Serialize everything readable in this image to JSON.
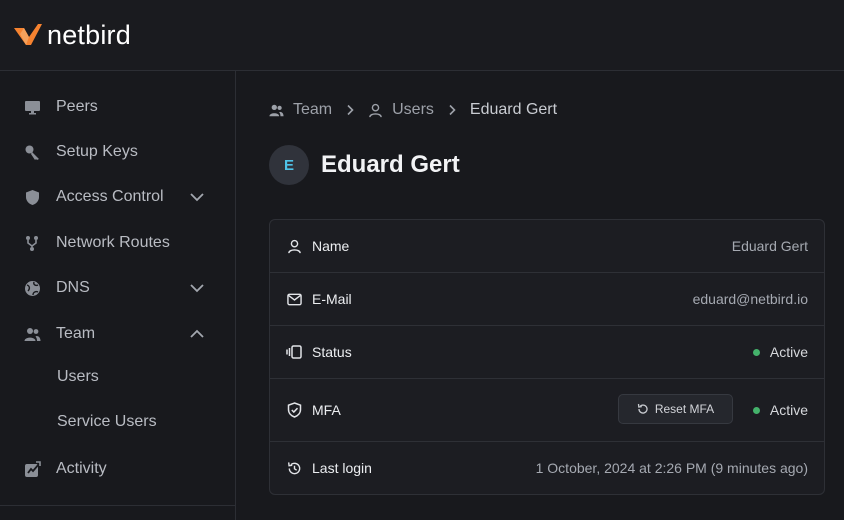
{
  "brand": {
    "name": "netbird",
    "logo_color": "#f68330"
  },
  "sidebar": {
    "items": [
      {
        "label": "Peers",
        "icon": "monitor-icon"
      },
      {
        "label": "Setup Keys",
        "icon": "key-icon"
      },
      {
        "label": "Access Control",
        "icon": "shield-icon",
        "expanded": false
      },
      {
        "label": "Network Routes",
        "icon": "route-icon"
      },
      {
        "label": "DNS",
        "icon": "globe-icon",
        "expanded": false
      },
      {
        "label": "Team",
        "icon": "users-icon",
        "expanded": true
      },
      {
        "label": "Activity",
        "icon": "activity-icon"
      }
    ],
    "team_subitems": [
      {
        "label": "Users"
      },
      {
        "label": "Service Users"
      }
    ]
  },
  "breadcrumb": {
    "items": [
      {
        "label": "Team",
        "icon": "users-icon"
      },
      {
        "label": "Users",
        "icon": "user-icon"
      },
      {
        "label": "Eduard Gert"
      }
    ]
  },
  "user": {
    "initial": "E",
    "name": "Eduard Gert"
  },
  "details": {
    "rows": [
      {
        "label": "Name",
        "value": "Eduard Gert",
        "icon": "user-icon"
      },
      {
        "label": "E-Mail",
        "value": "eduard@netbird.io",
        "icon": "mail-icon"
      },
      {
        "label": "Status",
        "value": "Active",
        "icon": "status-icon"
      },
      {
        "label": "MFA",
        "value": "Active",
        "icon": "shield-check-icon",
        "action": "Reset MFA"
      },
      {
        "label": "Last login",
        "value": "1 October, 2024 at 2:26 PM (9 minutes ago)",
        "icon": "history-icon"
      }
    ]
  },
  "colors": {
    "accent": "#f68330",
    "active": "#44b26b",
    "avatar_text": "#4fc3e8"
  }
}
